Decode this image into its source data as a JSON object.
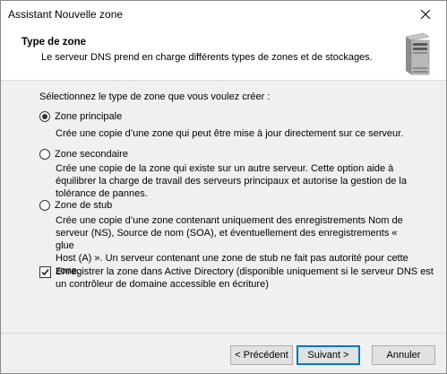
{
  "window": {
    "title": "Assistant Nouvelle zone"
  },
  "header": {
    "title": "Type de zone",
    "subtitle": "Le serveur DNS prend en charge différents types de zones et de stockages."
  },
  "prompt": "Sélectionnez le type de zone que vous voulez créer :",
  "options": [
    {
      "label": "Zone principale",
      "checked": true,
      "description": "Crée une copie d’une zone qui peut être mise à jour directement sur ce serveur."
    },
    {
      "label": "Zone secondaire",
      "checked": false,
      "description_lines": [
        "Crée une copie de la zone qui existe sur un autre serveur. Cette option aide à",
        "équilibrer la charge de travail des serveurs principaux et autorise la gestion de la",
        "tolérance de pannes."
      ]
    },
    {
      "label": "Zone de stub",
      "checked": false,
      "description_lines": [
        "Crée une copie d’une zone contenant uniquement des enregistrements Nom de",
        "serveur (NS), Source de nom (SOA), et éventuellement des enregistrements « glue",
        "Host (A) ». Un serveur contenant une zone de stub ne fait pas autorité pour cette",
        "zone."
      ]
    }
  ],
  "ad_checkbox": {
    "checked": true,
    "label_lines": [
      "Enregistrer la zone dans Active Directory (disponible uniquement si le serveur DNS est",
      "un contrôleur de domaine accessible en écriture)"
    ]
  },
  "buttons": {
    "back": "< Précédent",
    "next": "Suivant >",
    "cancel": "Annuler"
  }
}
